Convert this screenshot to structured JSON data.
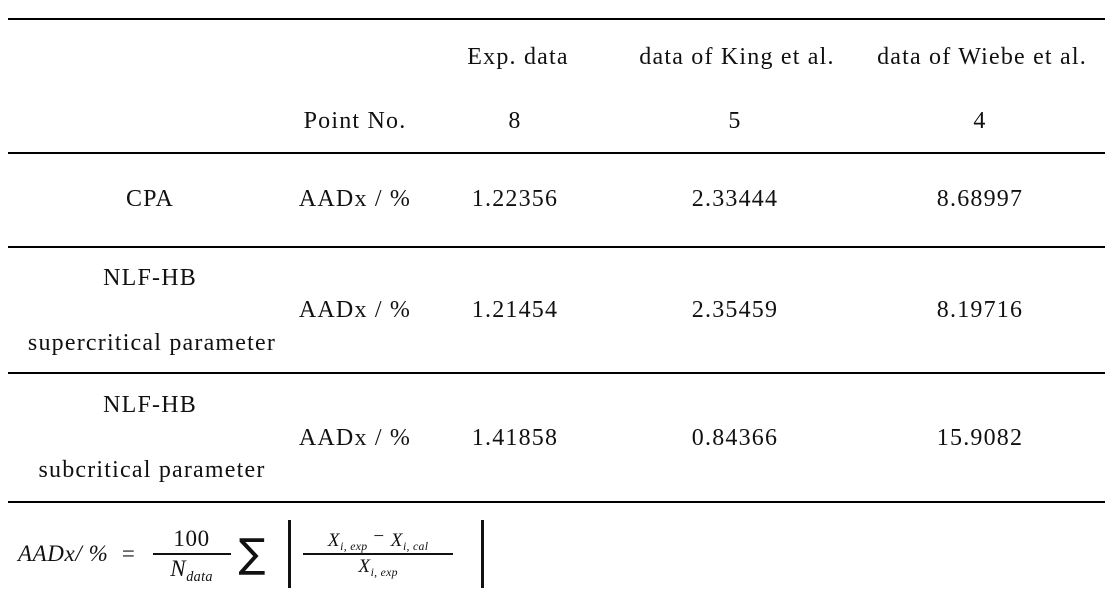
{
  "table": {
    "column_headers": [
      "",
      "",
      "Exp. data",
      "data of King et al.",
      "data of Wiebe et al."
    ],
    "point_no_label": "Point No.",
    "point_counts": [
      "8",
      "5",
      "4"
    ],
    "rows": [
      {
        "model": "CPA",
        "model_line2": "",
        "metric": "AADx / %",
        "values": [
          "1.22356",
          "2.33444",
          "8.68997"
        ]
      },
      {
        "model": "NLF-HB",
        "model_line2": "supercritical parameter",
        "metric": "AADx / %",
        "values": [
          "1.21454",
          "2.35459",
          "8.19716"
        ]
      },
      {
        "model": "NLF-HB",
        "model_line2": "subcritical parameter",
        "metric": "AADx / %",
        "values": [
          "1.41858",
          "0.84366",
          "15.9082"
        ]
      }
    ]
  },
  "formula": {
    "lhs": "AADx/ %",
    "equals": "=",
    "coefficient_numerator": "100",
    "coefficient_denominator_symbol": "N",
    "coefficient_denominator_subscript": "data",
    "sum_symbol": "∑",
    "abs_open": "|",
    "abs_close": "|",
    "numerator_term1_symbol": "X",
    "numerator_term1_subscript": "i, exp",
    "numerator_operator": "−",
    "numerator_term2_symbol": "X",
    "numerator_term2_subscript": "i, cal",
    "denominator_symbol": "X",
    "denominator_subscript": "i, exp"
  },
  "style": {
    "rule_color": "#000000",
    "text_color": "#111111",
    "background": "#ffffff"
  }
}
